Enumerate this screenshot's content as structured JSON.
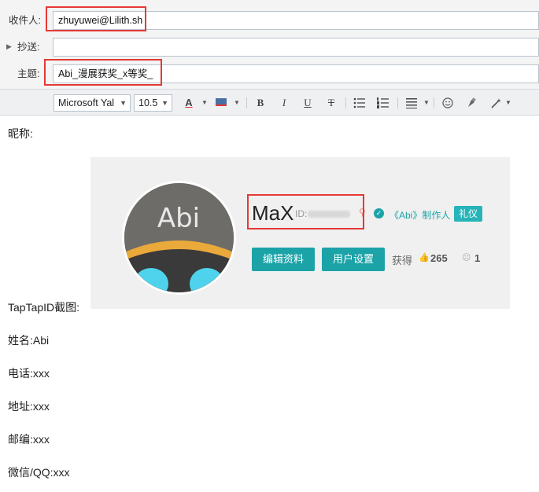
{
  "header": {
    "to_label": "收件人:",
    "to_value": "zhuyuwei@Lilith.sh",
    "cc_label": "抄送:",
    "cc_value": "",
    "subject_label": "主题:",
    "subject_value": "Abi_漫展获奖_x等奖_"
  },
  "toolbar": {
    "font_family": "Microsoft Yal",
    "font_size": "10.5",
    "buttons": [
      "font-color",
      "highlight",
      "bold",
      "italic",
      "underline",
      "strikethrough",
      "bullet-list",
      "numbered-list",
      "align",
      "emoji",
      "clear-format",
      "magic-wand"
    ]
  },
  "body": {
    "nickname_line": "昵称:",
    "screenshot_label": "TapTapID截图:",
    "name_line": "姓名:Abi",
    "phone_line": "电话:xxx",
    "address_line": "地址:xxx",
    "zip_line": "邮编:xxx",
    "contact_line": "微信/QQ:xxx"
  },
  "profile_card": {
    "avatar_text": "Abi",
    "nickname": "MaX",
    "id_label": "ID:",
    "creator_text": "《Abi》制作人",
    "badge": "礼仪",
    "edit_button": "编辑资料",
    "settings_button": "用户设置",
    "earned_label": "获得",
    "likes": "265",
    "dislikes": "1"
  },
  "colors": {
    "accent": "#1ba3a8",
    "highlight_box": "#e53935",
    "card_bg": "#f0f0f0"
  }
}
